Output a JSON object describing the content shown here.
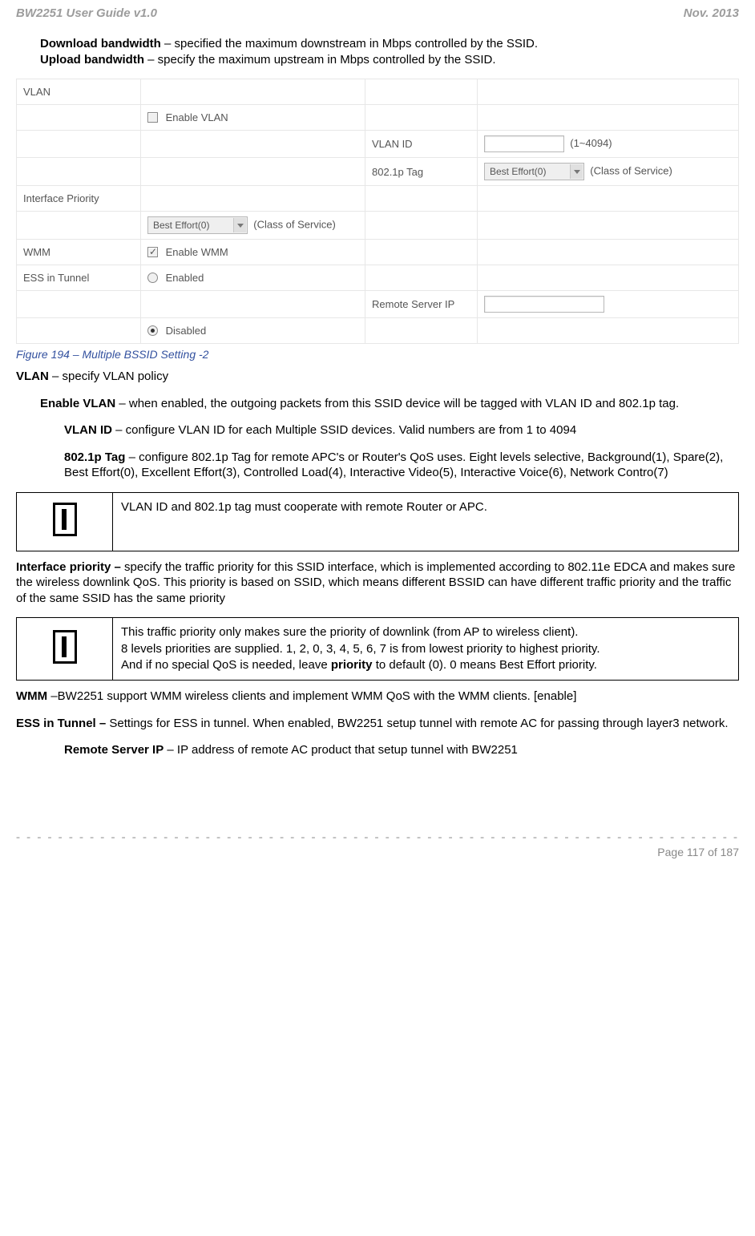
{
  "header": {
    "left": "BW2251 User Guide v1.0",
    "right": "Nov.  2013"
  },
  "p_download": {
    "b": "Download bandwidth",
    "t": " – specified the maximum downstream in Mbps controlled by the SSID."
  },
  "p_upload": {
    "b": "Upload bandwidth",
    "t": " – specify the maximum upstream in Mbps controlled by the SSID."
  },
  "form": {
    "vlan_label": "VLAN",
    "enable_vlan": "Enable VLAN",
    "vlan_id": "VLAN ID",
    "vlan_range": "(1~4094)",
    "tag_8021p": "802.1p Tag",
    "best_effort": "Best Effort(0)",
    "cos": "(Class of Service)",
    "iface_priority": "Interface Priority",
    "wmm": "WMM",
    "enable_wmm": "Enable WMM",
    "ess": "ESS in Tunnel",
    "enabled": "Enabled",
    "remote_ip": "Remote Server IP",
    "disabled": "Disabled"
  },
  "figcap": "Figure 194 –  Multiple BSSID Setting -2",
  "vlan": {
    "b": "VLAN ",
    "t": " – specify VLAN policy"
  },
  "enable_vlan": {
    "b": "Enable VLAN",
    "t": " – when enabled, the outgoing packets from this SSID device will be tagged with VLAN ID and 802.1p tag."
  },
  "vlan_id": {
    "b": "VLAN ID",
    "t": " – configure VLAN ID for each Multiple SSID devices. Valid numbers are from 1 to 4094"
  },
  "tag_8021p": {
    "b": "802.1p Tag",
    "t": " – configure 802.1p Tag for remote APC's or Router's QoS uses. Eight levels selective, Background(1), Spare(2), Best Effort(0), Excellent Effort(3), Controlled Load(4), Interactive Video(5), Interactive Voice(6), Network Contro(7)"
  },
  "note1": "VLAN ID and 802.1p tag must cooperate with remote Router or APC.",
  "iface": {
    "b": "Interface priority – ",
    "t": "specify the traffic priority for this SSID interface, which is implemented according to 802.11e EDCA and makes sure the wireless downlink QoS. This priority is based on SSID, which means different BSSID can have different traffic priority and the traffic of the same SSID has the same priority"
  },
  "note2": {
    "l1": "This traffic priority only makes sure the priority of downlink (from AP to wireless client).",
    "l2": "8 levels priorities are supplied. 1, 2, 0, 3, 4, 5, 6, 7 is from lowest priority to highest priority.",
    "l3a": "And if no special QoS is needed, leave ",
    "l3b": "priority",
    "l3c": " to default (0). 0 means Best Effort priority."
  },
  "wmm": {
    "b": "WMM ",
    "t": "–BW2251 support WMM wireless clients and implement WMM QoS with the WMM clients. [enable]"
  },
  "ess": {
    "b": "ESS in Tunnel – ",
    "t": "Settings for ESS in tunnel. When enabled, BW2251 setup tunnel with remote AC for passing through layer3 network."
  },
  "remote": {
    "b": "Remote Server IP",
    "t": " – IP address of remote AC product that setup tunnel with BW2251"
  },
  "footer": {
    "page": "Page 117 of 187"
  }
}
